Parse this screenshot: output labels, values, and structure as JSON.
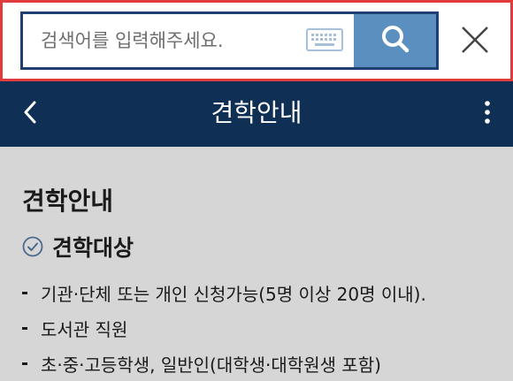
{
  "search": {
    "placeholder": "검색어를 입력해주세요.",
    "value": ""
  },
  "header": {
    "title": "견학안내"
  },
  "main": {
    "page_title": "견학안내",
    "section_heading": "견학대상",
    "items": [
      "기관·단체 또는 개인 신청가능(5명 이상 20명 이내).",
      "도서관 직원",
      "초·중·고등학생, 일반인(대학생·대학원생 포함)"
    ]
  },
  "icons": {
    "keyboard": "keyboard-icon",
    "search": "search-icon",
    "close": "close-icon",
    "back": "chevron-left-icon",
    "more": "more-vertical-icon",
    "check": "check-circle-icon"
  },
  "colors": {
    "highlight_border": "#e23b3b",
    "search_border": "#1e3f72",
    "search_button": "#5b8fc0",
    "header_bg": "#0f2f55",
    "content_bg": "#d6d6d6"
  }
}
